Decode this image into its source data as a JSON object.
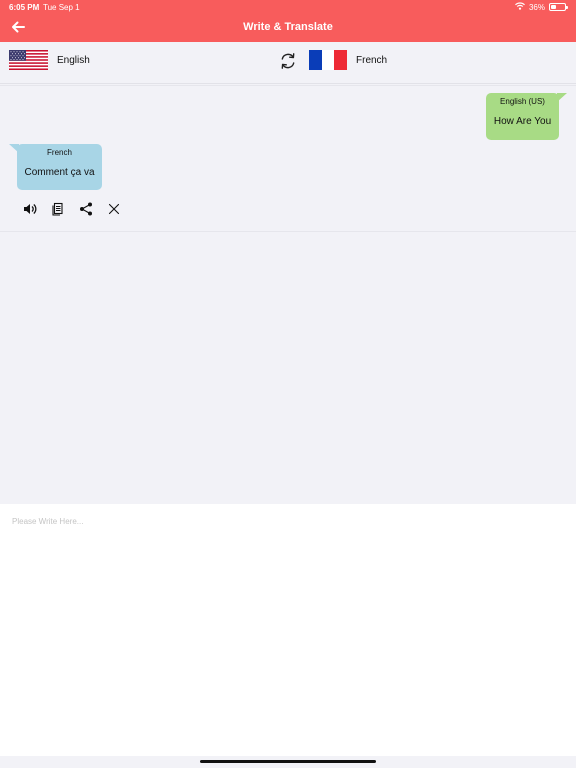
{
  "status_bar": {
    "time": "6:05 PM",
    "date": "Tue Sep 1",
    "battery": "36%",
    "battery_level": 0.36
  },
  "header": {
    "title": "Write & Translate",
    "background_color": "#f85c5c",
    "back_icon": "arrow-left-icon"
  },
  "languages": {
    "source": {
      "name": "English",
      "flag": "us-flag"
    },
    "target": {
      "name": "French",
      "flag": "france-flag"
    },
    "swap_icon": "refresh-icon"
  },
  "conversation": {
    "source_message": {
      "language": "English (US)",
      "text": "How Are You",
      "color": "#a8db85"
    },
    "translated_message": {
      "language": "French",
      "text": "Comment ça va",
      "color": "#a8d5e6"
    },
    "actions": [
      "speaker-icon",
      "copy-icon",
      "share-icon",
      "close-icon"
    ]
  },
  "input": {
    "placeholder": "Please Write Here...",
    "value": ""
  }
}
